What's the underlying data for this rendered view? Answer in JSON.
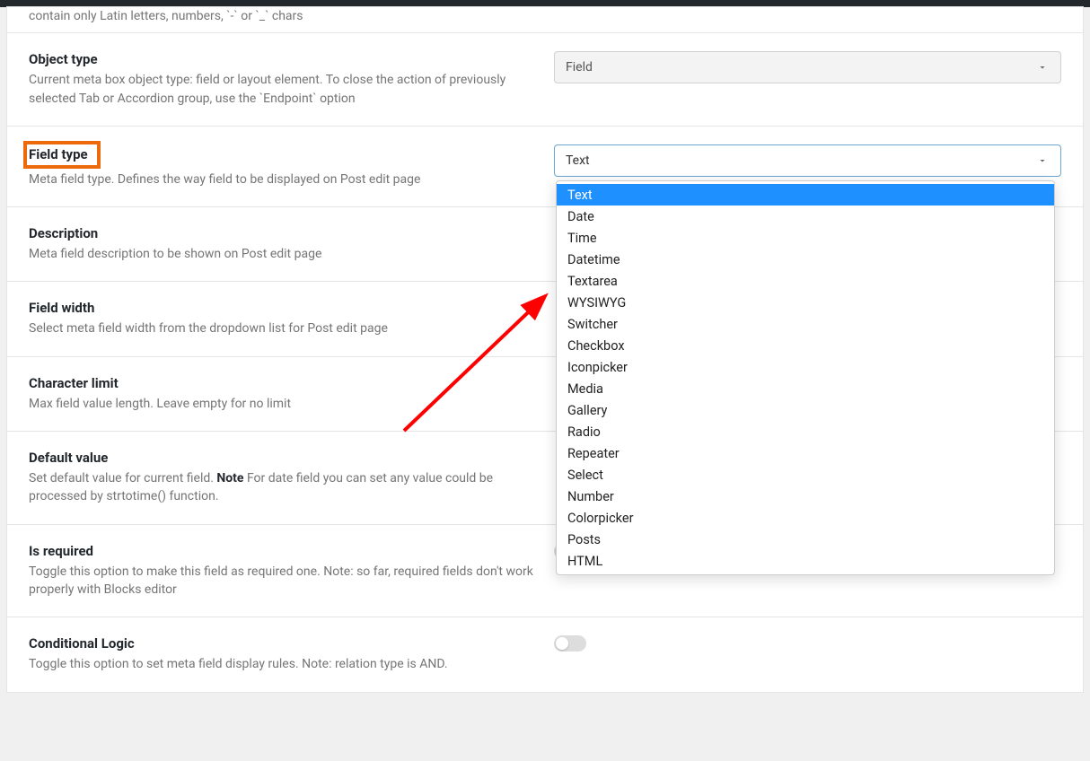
{
  "rows": {
    "partial_top": {
      "desc_fragment": "contain only Latin letters, numbers, `-` or `_` chars"
    },
    "object_type": {
      "title": "Object type",
      "desc": "Current meta box object type: field or layout element. To close the action of previously selected Tab or Accordion group, use the `Endpoint` option",
      "value": "Field"
    },
    "field_type": {
      "title": "Field type",
      "desc": "Meta field type. Defines the way field to be displayed on Post edit page",
      "value": "Text",
      "options": [
        "Text",
        "Date",
        "Time",
        "Datetime",
        "Textarea",
        "WYSIWYG",
        "Switcher",
        "Checkbox",
        "Iconpicker",
        "Media",
        "Gallery",
        "Radio",
        "Repeater",
        "Select",
        "Number",
        "Colorpicker",
        "Posts",
        "HTML"
      ]
    },
    "description": {
      "title": "Description",
      "desc": "Meta field description to be shown on Post edit page"
    },
    "field_width": {
      "title": "Field width",
      "desc": "Select meta field width from the dropdown list for Post edit page"
    },
    "character_limit": {
      "title": "Character limit",
      "desc": "Max field value length. Leave empty for no limit"
    },
    "default_value": {
      "title": "Default value",
      "desc_pre": "Set default value for current field. ",
      "desc_bold": "Note",
      "desc_post": " For date field you can set any value could be processed by strtotime() function."
    },
    "is_required": {
      "title": "Is required",
      "desc": "Toggle this option to make this field as required one. Note: so far, required fields don't work properly with Blocks editor"
    },
    "conditional_logic": {
      "title": "Conditional Logic",
      "desc": "Toggle this option to set meta field display rules. Note: relation type is AND."
    }
  }
}
